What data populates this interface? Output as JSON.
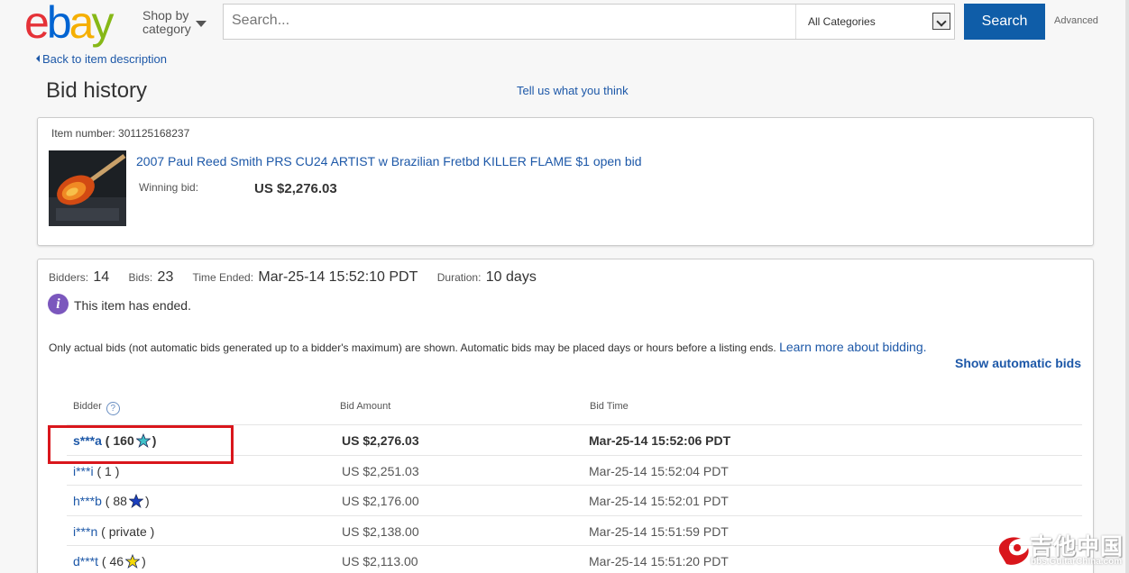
{
  "header": {
    "logo": [
      "e",
      "b",
      "a",
      "y"
    ],
    "logo_colors": [
      "#e53238",
      "#0064d2",
      "#f5af02",
      "#86b817"
    ],
    "shop_by": [
      "Shop by",
      "category"
    ],
    "search_placeholder": "Search...",
    "category": "All Categories",
    "search_button": "Search",
    "advanced": "Advanced"
  },
  "nav": {
    "back_link": "Back to item description",
    "page_title": "Bid history",
    "feedback_link": "Tell us what you think"
  },
  "item": {
    "number_label": "Item number:",
    "number": "301125168237",
    "title": "2007 Paul Reed Smith PRS CU24 ARTIST w Brazilian Fretbd KILLER FLAME $1 open bid",
    "winning_label": "Winning bid:",
    "winning_bid": "US $2,276.03"
  },
  "summary": {
    "bidders_label": "Bidders:",
    "bidders": "14",
    "bids_label": "Bids:",
    "bids": "23",
    "ended_label": "Time Ended:",
    "ended": "Mar-25-14 15:52:10 PDT",
    "duration_label": "Duration:",
    "duration": "10 days",
    "status": "This item has ended.",
    "note": "Only actual bids (not automatic bids generated up to a bidder's maximum) are shown. Automatic bids may be placed days or hours before a listing ends.",
    "learn_more": "Learn more about bidding.",
    "show_automatic": "Show automatic bids"
  },
  "table": {
    "headers": [
      "Bidder",
      "Bid Amount",
      "Bid Time"
    ],
    "rows": [
      {
        "bidder": "s***a",
        "score": "160",
        "star": "#3fc1c9",
        "amount": "US $2,276.03",
        "time": "Mar-25-14 15:52:06 PDT"
      },
      {
        "bidder": "i***i",
        "score": "1",
        "star": "",
        "amount": "US $2,251.03",
        "time": "Mar-25-14 15:52:04 PDT"
      },
      {
        "bidder": "h***b",
        "score": "88",
        "star": "#1b3fbf",
        "amount": "US $2,176.00",
        "time": "Mar-25-14 15:52:01 PDT"
      },
      {
        "bidder": "i***n",
        "score": "private",
        "star": "",
        "amount": "US $2,138.00",
        "time": "Mar-25-14 15:51:59 PDT"
      },
      {
        "bidder": "d***t",
        "score": "46",
        "star": "#f5d90a",
        "amount": "US $2,113.00",
        "time": "Mar-25-14 15:51:20 PDT"
      }
    ]
  },
  "watermark": {
    "text": "吉他中国",
    "sub": "bbs.GuitarChina.com"
  }
}
